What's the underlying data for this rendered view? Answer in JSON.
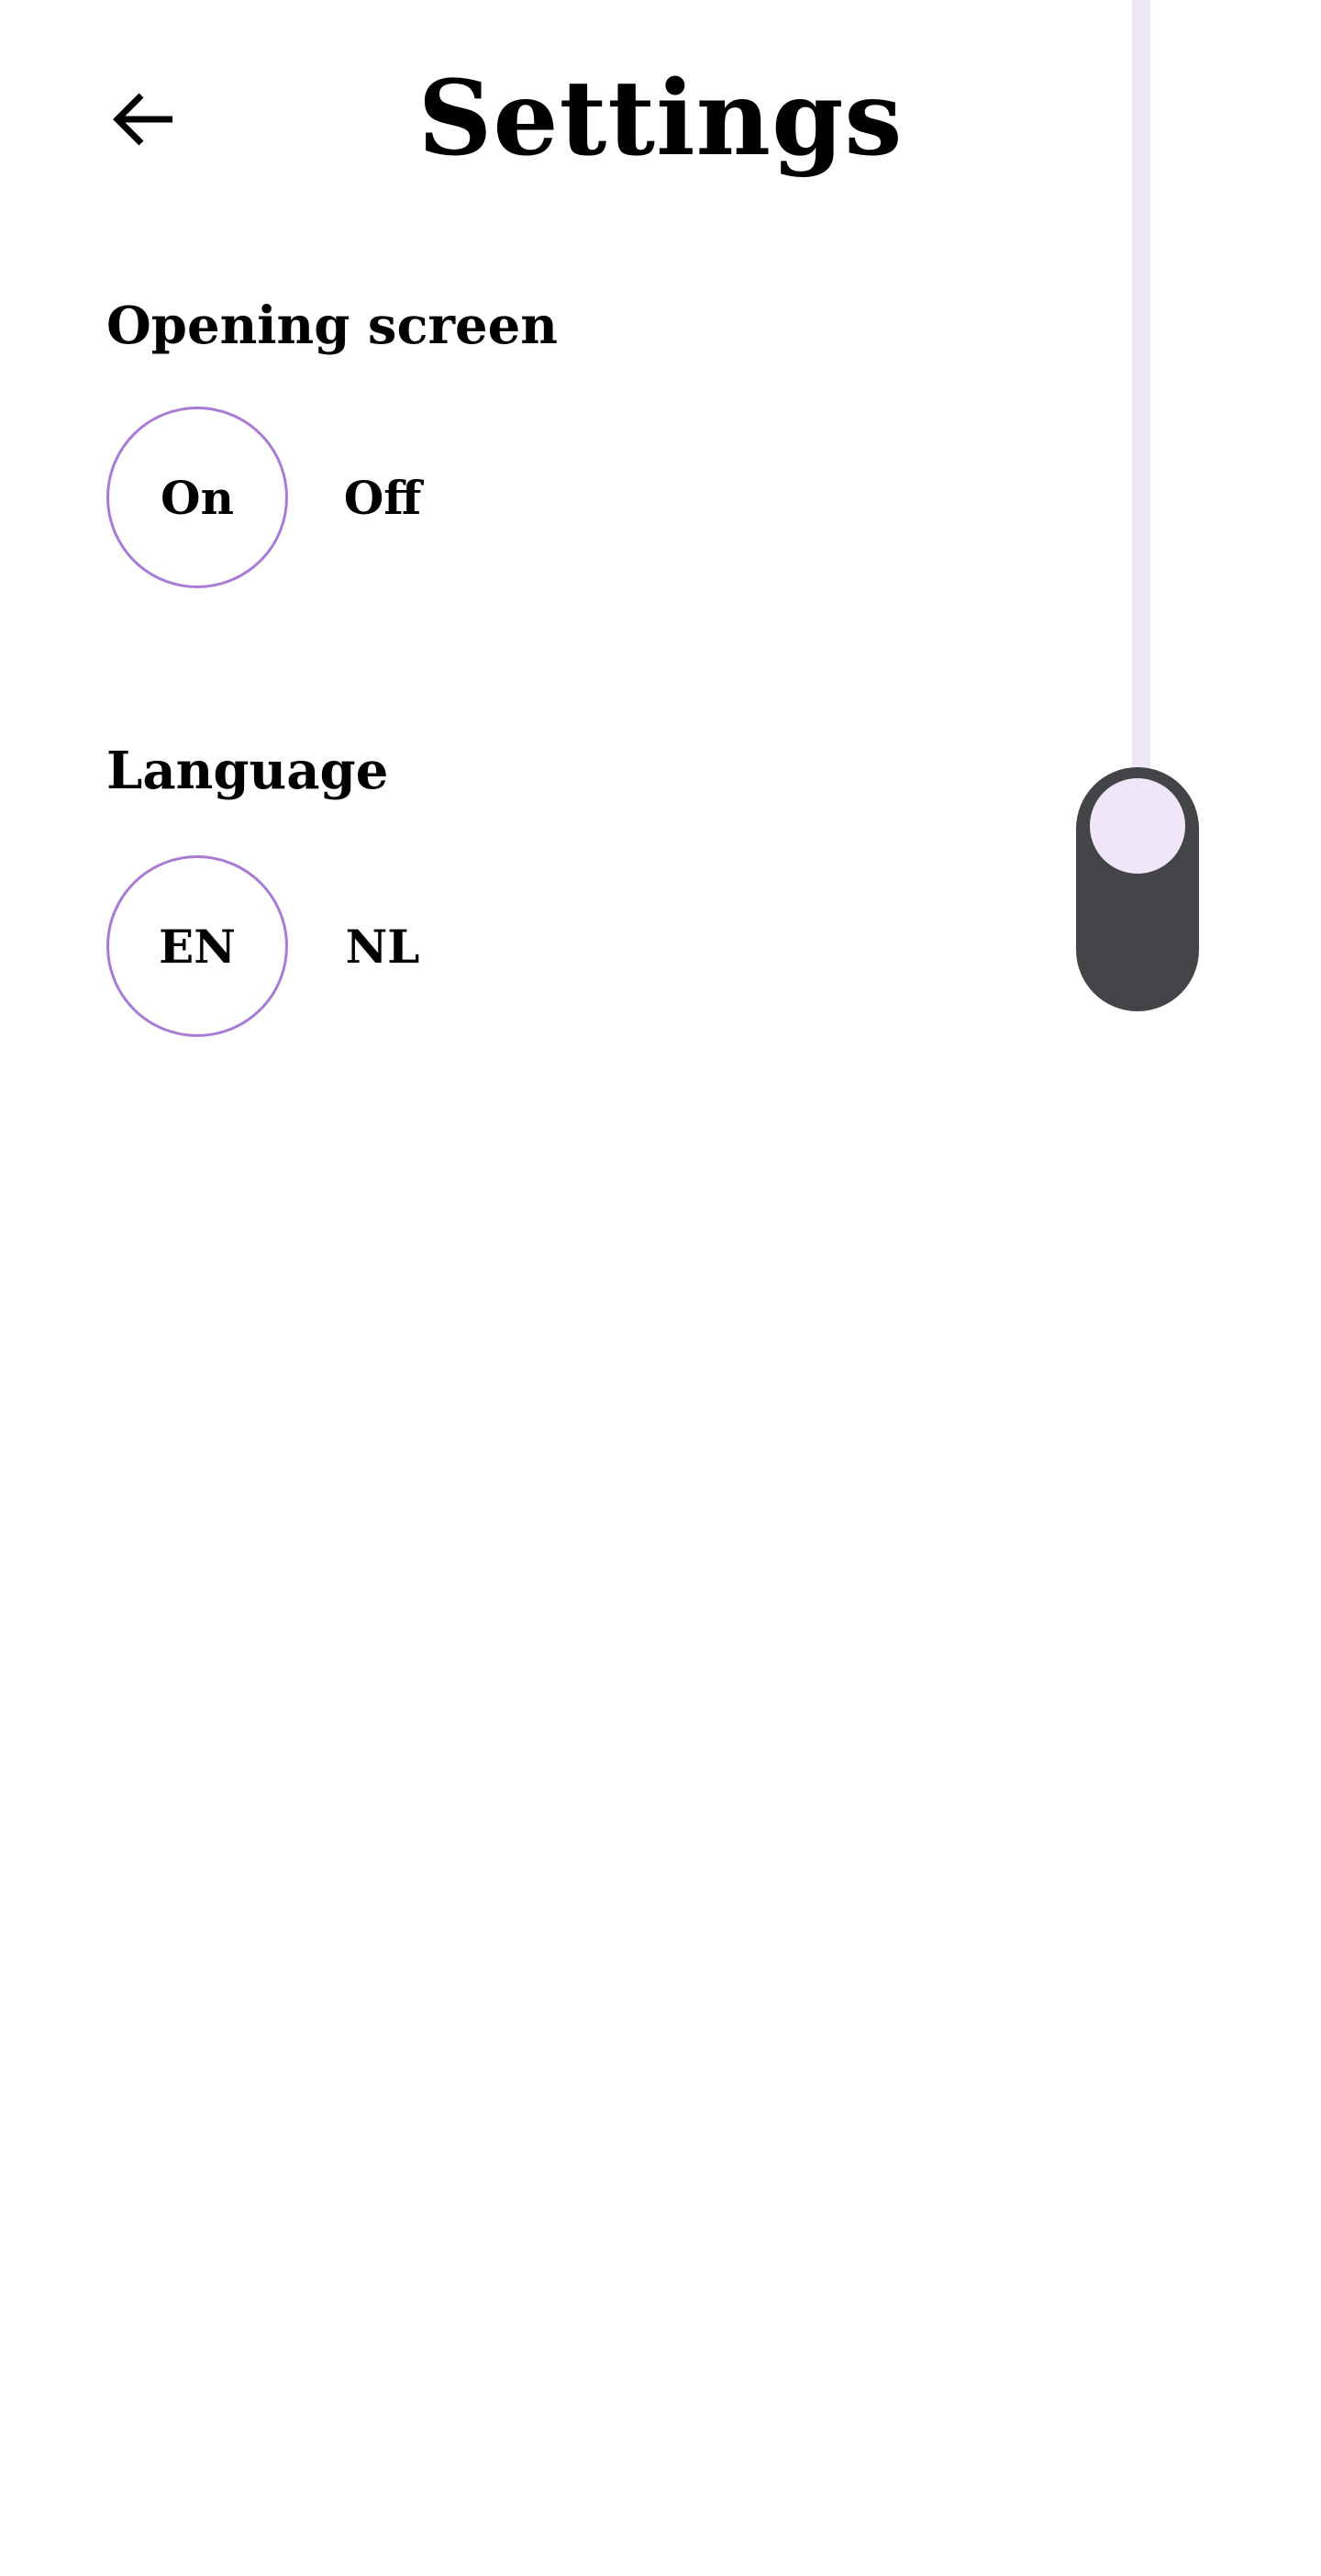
{
  "header": {
    "title": "Settings",
    "back_icon": "arrow-left-icon"
  },
  "opening_screen": {
    "label": "Opening screen",
    "options": [
      "On",
      "Off"
    ],
    "selected": "On"
  },
  "language": {
    "label": "Language",
    "options": [
      "EN",
      "NL"
    ],
    "selected": "EN"
  },
  "colors": {
    "selected_ring": "#a97bd6",
    "scroll_track": "#efe6f8",
    "scroll_handle": "#424448",
    "text": "#000000",
    "background": "#ffffff"
  }
}
